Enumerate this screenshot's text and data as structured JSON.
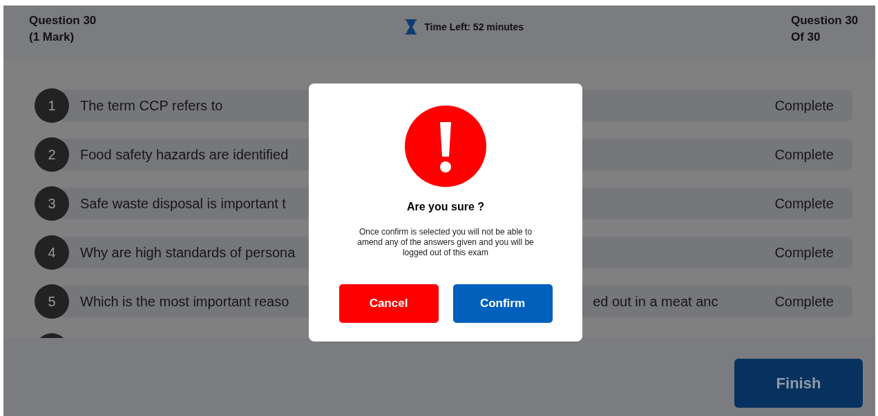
{
  "header": {
    "question": "Question 30",
    "marks": "(1 Mark)",
    "timer": "Time Left: 52 minutes",
    "position_line1": "Question 30",
    "position_line2": "Of 30"
  },
  "questions": [
    {
      "number": "1",
      "text": "The term CCP refers to",
      "status": "Complete"
    },
    {
      "number": "2",
      "text": "Food safety hazards are identified",
      "status": "Complete"
    },
    {
      "number": "3",
      "text": "Safe waste disposal is important t",
      "status": "Complete"
    },
    {
      "number": "4",
      "text": "Why are high standards of persona",
      "status": "Complete"
    },
    {
      "number": "5",
      "text": "Which is the most important reaso",
      "text_right": "ed out in a meat anc",
      "status": "Complete"
    }
  ],
  "finish_button": "Finish",
  "dialog": {
    "title": "Are you sure ?",
    "message": "Once confirm is selected you will not be able to amend any of the answers given and you will be logged out of this exam",
    "cancel": "Cancel",
    "confirm": "Confirm"
  }
}
